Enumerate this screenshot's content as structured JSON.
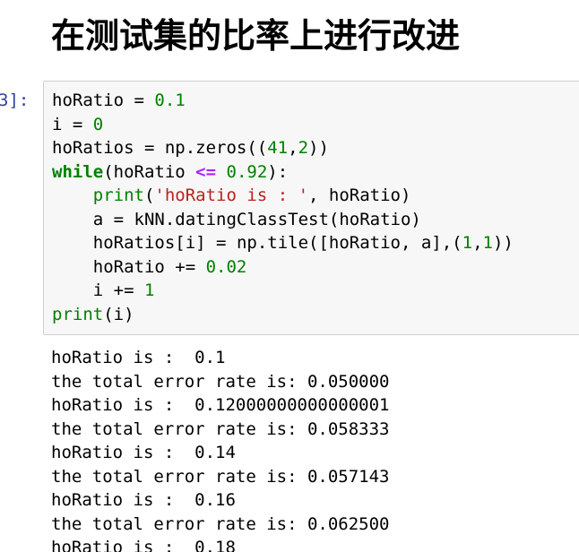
{
  "heading": "在测试集的比率上进行改进",
  "cell": {
    "prompt": "3]:",
    "code": [
      {
        "tokens": [
          [
            "n",
            "hoRatio "
          ],
          [
            "p",
            "= "
          ],
          [
            "num",
            "0.1"
          ]
        ]
      },
      {
        "tokens": [
          [
            "n",
            "i "
          ],
          [
            "p",
            "= "
          ],
          [
            "num",
            "0"
          ]
        ]
      },
      {
        "tokens": [
          [
            "n",
            "hoRatios "
          ],
          [
            "p",
            "= "
          ],
          [
            "n",
            "np.zeros(("
          ],
          [
            "num",
            "41"
          ],
          [
            "p",
            ","
          ],
          [
            "num",
            "2"
          ],
          [
            "p",
            "))"
          ]
        ]
      },
      {
        "tokens": [
          [
            "kw",
            "while"
          ],
          [
            "p",
            "(hoRatio "
          ],
          [
            "op",
            "<="
          ],
          [
            "p",
            " "
          ],
          [
            "num",
            "0.92"
          ],
          [
            "p",
            "):"
          ]
        ]
      },
      {
        "tokens": [
          [
            "p",
            "    "
          ],
          [
            "bi",
            "print"
          ],
          [
            "p",
            "("
          ],
          [
            "str",
            "'hoRatio is : '"
          ],
          [
            "p",
            ", hoRatio)"
          ]
        ]
      },
      {
        "tokens": [
          [
            "p",
            "    "
          ],
          [
            "n",
            "a "
          ],
          [
            "p",
            "= "
          ],
          [
            "n",
            "kNN.datingClassTest(hoRatio)"
          ]
        ]
      },
      {
        "tokens": [
          [
            "p",
            "    "
          ],
          [
            "n",
            "hoRatios[i] "
          ],
          [
            "p",
            "= "
          ],
          [
            "n",
            "np.tile([hoRatio, a],("
          ],
          [
            "num",
            "1"
          ],
          [
            "p",
            ","
          ],
          [
            "num",
            "1"
          ],
          [
            "p",
            "))"
          ]
        ]
      },
      {
        "tokens": [
          [
            "p",
            "    "
          ],
          [
            "n",
            "hoRatio "
          ],
          [
            "p",
            "+= "
          ],
          [
            "num",
            "0.02"
          ]
        ]
      },
      {
        "tokens": [
          [
            "p",
            "    "
          ],
          [
            "n",
            "i "
          ],
          [
            "p",
            "+= "
          ],
          [
            "num",
            "1"
          ]
        ]
      },
      {
        "tokens": [
          [
            "bi",
            "print"
          ],
          [
            "p",
            "(i)"
          ]
        ]
      }
    ]
  },
  "output": [
    "hoRatio is :  0.1",
    "the total error rate is: 0.050000",
    "hoRatio is :  0.12000000000000001",
    "the total error rate is: 0.058333",
    "hoRatio is :  0.14",
    "the total error rate is: 0.057143",
    "hoRatio is :  0.16",
    "the total error rate is: 0.062500",
    "hoRatio is :  0.18"
  ],
  "colors": {
    "keyword": "#008000",
    "number": "#008000",
    "string": "#ba2121",
    "operator": "#aa22ff",
    "prompt": "#303f9f",
    "cell_background": "#f7f7f7",
    "cell_border": "#cfcfcf"
  }
}
